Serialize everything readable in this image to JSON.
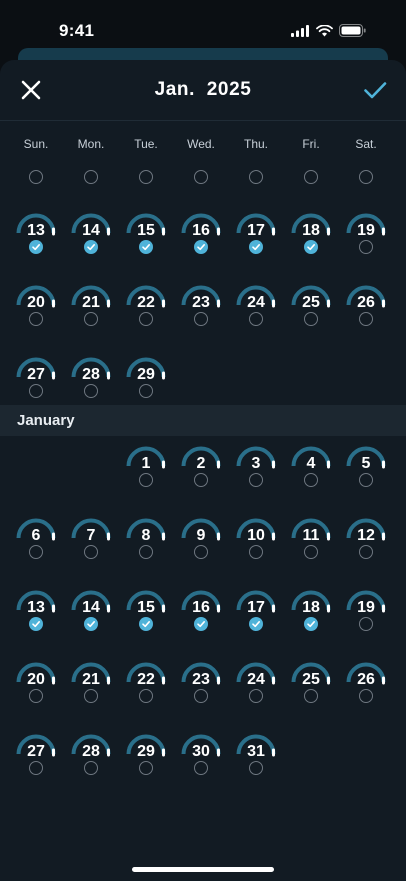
{
  "status": {
    "time": "9:41"
  },
  "header": {
    "title": "Jan.  2025",
    "close_icon": "close-icon",
    "confirm_icon": "checkmark-icon"
  },
  "weekdays": [
    "Sun.",
    "Mon.",
    "Tue.",
    "Wed.",
    "Thu.",
    "Fri.",
    "Sat."
  ],
  "colors": {
    "accent": "#4fb3d9",
    "ring": "#2a6f8a",
    "sheet": "#121b23",
    "month_bar": "#1c2730"
  },
  "section_1": {
    "leading_checks": 7,
    "rows": [
      [
        {
          "d": "13",
          "c": true
        },
        {
          "d": "14",
          "c": true
        },
        {
          "d": "15",
          "c": true
        },
        {
          "d": "16",
          "c": true
        },
        {
          "d": "17",
          "c": true
        },
        {
          "d": "18",
          "c": true
        },
        {
          "d": "19",
          "c": false
        }
      ],
      [
        {
          "d": "20",
          "c": false
        },
        {
          "d": "21",
          "c": false
        },
        {
          "d": "22",
          "c": false
        },
        {
          "d": "23",
          "c": false
        },
        {
          "d": "24",
          "c": false
        },
        {
          "d": "25",
          "c": false
        },
        {
          "d": "26",
          "c": false
        }
      ],
      [
        {
          "d": "27",
          "c": false
        },
        {
          "d": "28",
          "c": false
        },
        {
          "d": "29",
          "c": false
        }
      ]
    ]
  },
  "month_label": "January",
  "section_2": {
    "offset": 2,
    "rows": [
      [
        {
          "d": "1",
          "c": false
        },
        {
          "d": "2",
          "c": false
        },
        {
          "d": "3",
          "c": false
        },
        {
          "d": "4",
          "c": false
        },
        {
          "d": "5",
          "c": false
        }
      ],
      [
        {
          "d": "6",
          "c": false
        },
        {
          "d": "7",
          "c": false
        },
        {
          "d": "8",
          "c": false
        },
        {
          "d": "9",
          "c": false
        },
        {
          "d": "10",
          "c": false
        },
        {
          "d": "11",
          "c": false
        },
        {
          "d": "12",
          "c": false
        }
      ],
      [
        {
          "d": "13",
          "c": true
        },
        {
          "d": "14",
          "c": true
        },
        {
          "d": "15",
          "c": true
        },
        {
          "d": "16",
          "c": true
        },
        {
          "d": "17",
          "c": true
        },
        {
          "d": "18",
          "c": true
        },
        {
          "d": "19",
          "c": false
        }
      ],
      [
        {
          "d": "20",
          "c": false
        },
        {
          "d": "21",
          "c": false
        },
        {
          "d": "22",
          "c": false
        },
        {
          "d": "23",
          "c": false
        },
        {
          "d": "24",
          "c": false
        },
        {
          "d": "25",
          "c": false
        },
        {
          "d": "26",
          "c": false
        }
      ],
      [
        {
          "d": "27",
          "c": false
        },
        {
          "d": "28",
          "c": false
        },
        {
          "d": "29",
          "c": false
        },
        {
          "d": "30",
          "c": false
        },
        {
          "d": "31",
          "c": false
        }
      ]
    ]
  }
}
